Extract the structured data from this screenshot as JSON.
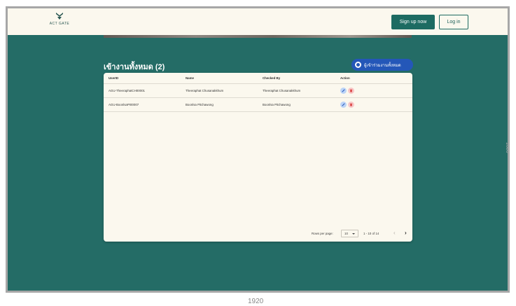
{
  "header": {
    "logo_text": "ACT GATE",
    "signup_label": "Sign up now",
    "login_label": "Log in"
  },
  "page": {
    "title": "เข้างานทั้งหมด (2)",
    "participants_button": "ผู้เข้าร่วมงานทั้งหมด"
  },
  "table": {
    "columns": [
      "UserID",
      "Name",
      "Checked By",
      "Action"
    ],
    "rows": [
      [
        "AGU-TheeraphatCH00001",
        "Theeraphat Chusanakkhum",
        "Theeraphat Chusanakkhum"
      ],
      [
        "AGU-BoonlsaPI00007",
        "Boonlsa Pitchawong",
        "Boonlsa Pitchawong"
      ]
    ]
  },
  "pagination": {
    "rows_per_page_label": "Rows per page:",
    "rows_per_page_value": "10",
    "range": "1 - 10 of 14",
    "prev": "‹",
    "next": "›"
  },
  "canvas": {
    "width_label": "1920",
    "height_label": "1080"
  },
  "colors": {
    "accent": "#1d6b62",
    "background_main": "#246c66",
    "header_bg": "#fbf8ee",
    "participants_button": "#2457b8"
  }
}
